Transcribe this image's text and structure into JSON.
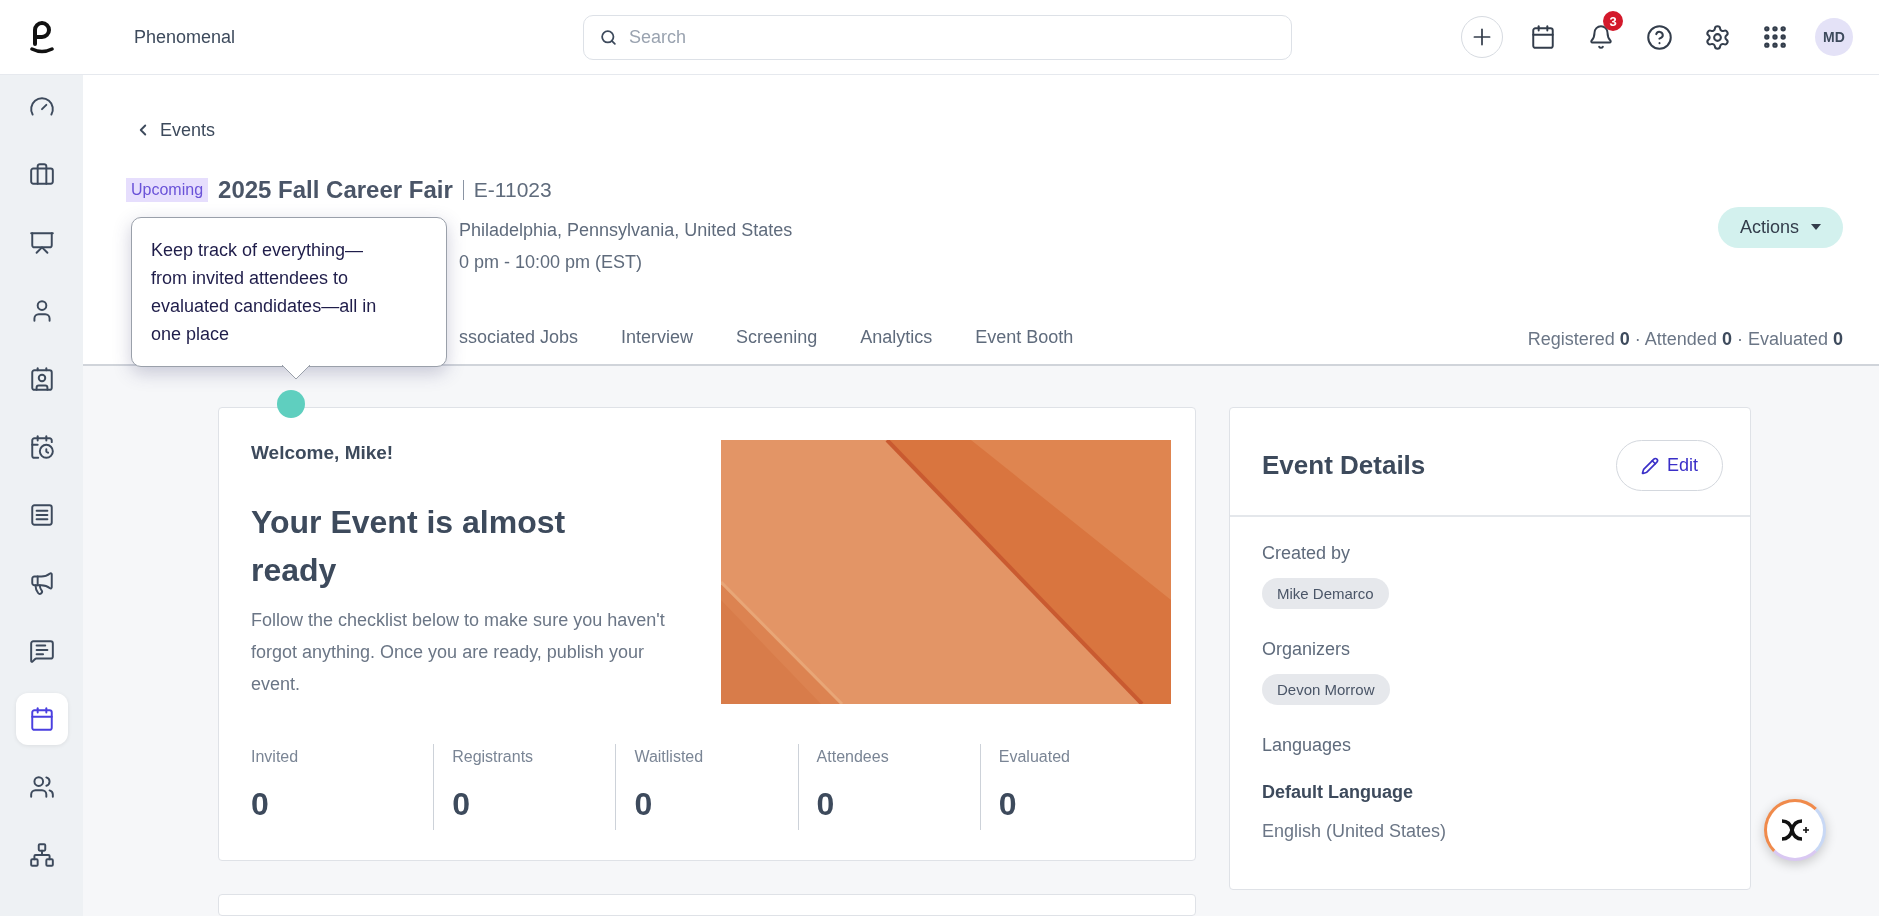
{
  "app": {
    "brand": "Phenomenal",
    "search_placeholder": "Search",
    "notification_count": "3",
    "avatar_initials": "MD"
  },
  "sidebar": {
    "items": [
      {
        "selected": false
      },
      {
        "selected": false
      },
      {
        "selected": false
      },
      {
        "selected": false
      },
      {
        "selected": false
      },
      {
        "selected": false
      },
      {
        "selected": false
      },
      {
        "selected": false
      },
      {
        "selected": false
      },
      {
        "selected": true
      },
      {
        "selected": false
      },
      {
        "selected": false
      }
    ]
  },
  "back_link": "Events",
  "event": {
    "status": "Upcoming",
    "title": "2025 Fall Career Fair",
    "id": "E-11023",
    "meta_lines": [
      {
        "rest": "Philadelphia, Pennsylvania, United States"
      },
      {
        "rest": "0 pm - 10:00 pm (EST)"
      }
    ]
  },
  "actions_button": "Actions",
  "tabs": [
    {
      "label": "ssociated Jobs",
      "selected": false
    },
    {
      "label": "Interview",
      "selected": false
    },
    {
      "label": "Screening",
      "selected": false
    },
    {
      "label": "Analytics",
      "selected": false
    },
    {
      "label": "Event Booth",
      "selected": false
    }
  ],
  "counts_summary": "Registered **0** · Attended **0** · Evaluated **0**",
  "tooltip": {
    "text": "Keep track of everything—from invited attendees to evaluated candidates—all in one place"
  },
  "welcome_card": {
    "greeting": "Welcome, Mike!",
    "heading": "Your Event is almost ready",
    "body": "Follow the checklist below to make sure you haven't forgot anything. Once you are ready, publish your event.",
    "stats": [
      {
        "label": "Invited",
        "value": "0"
      },
      {
        "label": "Registrants",
        "value": "0"
      },
      {
        "label": "Waitlisted",
        "value": "0"
      },
      {
        "label": "Attendees",
        "value": "0"
      },
      {
        "label": "Evaluated",
        "value": "0"
      }
    ]
  },
  "event_details": {
    "title": "Event Details",
    "edit_button": "Edit",
    "sections": [
      {
        "kind": "chip",
        "label": "Created by",
        "value": "Mike Demarco"
      },
      {
        "kind": "chip",
        "label": "Organizers",
        "value": "Devon Morrow"
      },
      {
        "kind": "language",
        "label": "Languages",
        "sublabel": "Default Language",
        "value": "English (United States)"
      }
    ]
  }
}
